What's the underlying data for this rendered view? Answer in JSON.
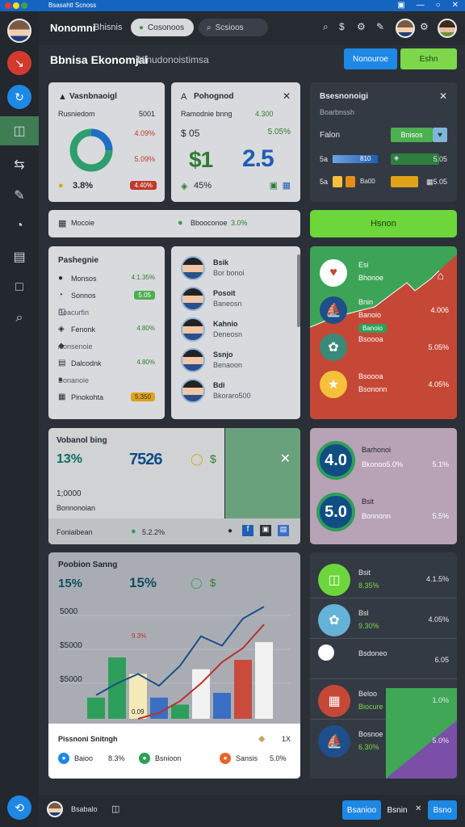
{
  "window": {
    "title": "Bsasahtl Scnoss"
  },
  "header": {
    "app_name": "Nonomni",
    "app_sub": "Bhisnis",
    "tab_active": "Cosonoos",
    "search_placeholder": "Scsioos",
    "icons": [
      "search-icon",
      "dollar-icon",
      "bell-icon",
      "pin-icon"
    ]
  },
  "page": {
    "title": "Bbnisa Ekonomjai",
    "subtitle": "Nlnudonoistimsa",
    "btn_primary": "Nonouroe",
    "btn_secondary": "Eshn"
  },
  "card1": {
    "title": "Vasnbnaoigl",
    "label": "Rusniedom",
    "v_top": "5001",
    "v_mid1": "4.09%",
    "v_mid2": "5.09%",
    "pct": "3.8%",
    "badge": "4.40%"
  },
  "card2": {
    "title": "Pohognod",
    "line": "Ramodnie bnng",
    "val_a": "4.300",
    "label_a": "05",
    "label_b": "5.05%",
    "big_left": "$1",
    "big_right": "2.5",
    "pct": "45%"
  },
  "card3": {
    "title": "Bsesnonoigi",
    "sub": "Boarbnssh",
    "label": "Falon",
    "tag": "Bnisos",
    "rows": [
      {
        "l": "5a",
        "r": "810"
      },
      {
        "l": "5a",
        "r": "Ba00"
      }
    ],
    "row_right": [
      "5.05",
      "5.05"
    ]
  },
  "strip": {
    "label": "Mocoie",
    "status": "Bbooconoe",
    "status_pct": "3.0%",
    "button": "Hsnon"
  },
  "list_card": {
    "title": "Pashegnie",
    "items": [
      {
        "name": "Monsos",
        "value": "4.1.35%"
      },
      {
        "name": "Sonnos",
        "value": "5.05"
      },
      {
        "name": "Boacurfin",
        "value": ""
      },
      {
        "name": "Fenonk",
        "value": "4.80%"
      },
      {
        "name": "Aonsenoie",
        "value": ""
      },
      {
        "name": "Dalcodnk",
        "value": "4.80%"
      },
      {
        "name": "Bonanoie",
        "value": ""
      },
      {
        "name": "Pinokohta",
        "value": "5.350"
      }
    ]
  },
  "people": [
    {
      "name": "Bsik",
      "role": "Bor bonoi"
    },
    {
      "name": "Posoit",
      "role": "Baneosn"
    },
    {
      "name": "Kahnio",
      "role": "Deneosn"
    },
    {
      "name": "Ssnjo",
      "role": "Benaoon"
    },
    {
      "name": "Bdi",
      "role": "Bkoraro500"
    }
  ],
  "colorful_card": {
    "items": [
      {
        "name": "Esi",
        "sub": "Bhonoe",
        "value": ""
      },
      {
        "name": "Bnin",
        "sub": "Banoio",
        "value": "4.006"
      },
      {
        "name": "Bsoooa",
        "sub": "",
        "value": "5.05%"
      },
      {
        "name": "Bsoooa",
        "sub": "Bsononn",
        "value": "4.05%"
      }
    ],
    "tag": "Banoio"
  },
  "mid_card": {
    "title": "Vobanol bing",
    "pct": "13%",
    "big": "7526",
    "num": "1;0000",
    "sub": "Bonnonoian",
    "footer": "Foniaibean",
    "footer_val": "5.2.2%"
  },
  "circles_card": {
    "items": [
      {
        "big": "4.0",
        "name": "Barhonoi",
        "sub": "Bkonoo5.0%",
        "value": "5.1%"
      },
      {
        "big": "5.0",
        "name": "Bsit",
        "sub": "Bonnonn",
        "value": "5.5%"
      }
    ]
  },
  "chart_card": {
    "title": "Poobion Sanng",
    "pct_left": "15%",
    "pct_right": "15%",
    "tooltip": "9.3%",
    "bar_label": "0.09",
    "footer_title": "Pissnoni Snitngh",
    "footer_close": "1X",
    "legend": [
      {
        "name": "Baioo",
        "value": "8.3%"
      },
      {
        "name": "Bsnioon",
        "value": ""
      },
      {
        "name": "Sansis",
        "value": "5.0%"
      }
    ]
  },
  "chart_data": {
    "type": "bar",
    "title": "Poobion Sanng",
    "y_ticks": [
      "5000",
      "$5000",
      "$5000"
    ],
    "values": [
      18,
      52,
      38,
      18,
      12,
      42,
      22,
      50,
      65
    ],
    "line_values": [
      20,
      30,
      38,
      28,
      45,
      70,
      62,
      85,
      95
    ],
    "trend_values": [
      0,
      5,
      15,
      30,
      48,
      60,
      80
    ],
    "ylim": [
      0,
      100
    ],
    "colors": [
      "#2e9e5b",
      "#2e9e5b",
      "#f4eab9",
      "#3a6fc4",
      "#2e9e5b",
      "#f2f2f2",
      "#3a6fc4",
      "#c94b3c",
      "#f2f2f2"
    ]
  },
  "right_list": {
    "items": [
      {
        "name": "Bsit",
        "sub": "8.35%",
        "value": "4.1.5%"
      },
      {
        "name": "Bsl",
        "sub": "9.30%",
        "value": "4.05%"
      },
      {
        "name": "Bsdoneo",
        "sub": "",
        "value": "6.05"
      },
      {
        "name": "Beloo",
        "sub": "Biocure",
        "value": "1.0%"
      },
      {
        "name": "Bosnoe",
        "sub": "6.30%",
        "value": "5.0%"
      }
    ]
  },
  "footer": {
    "user": "Bsabalo",
    "btn1": "Bsanioo",
    "btn2": "Bsnin",
    "btn3": "Bsno"
  },
  "colors": {
    "accent_blue": "#1e88e5",
    "accent_green": "#6cd63a",
    "teal": "#2aa39a"
  }
}
